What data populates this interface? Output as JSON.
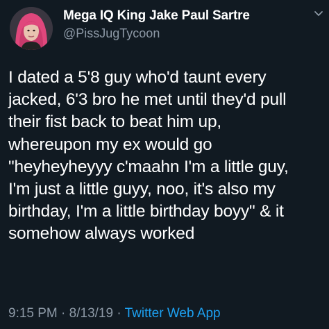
{
  "tweet": {
    "author": {
      "display_name": "Mega IQ King Jake Paul Sartre",
      "handle": "@PissJugTycoon",
      "avatar": "profile-photo"
    },
    "menu_icon": "chevron-down-icon",
    "body_lines": [
      "I dated a 5'8 guy who'd taunt every",
      "jacked, 6'3 bro he met until they'd pull",
      "their fist back to beat him up,",
      "whereupon my ex would go",
      "\"heyheyheyyy c'maahn I'm a little guy,",
      "I'm just a little guyy, noo, it's also my",
      "birthday, I'm a little birthday boyy\" & it",
      "somehow always worked"
    ],
    "time": "9:15 PM",
    "separator": "·",
    "date": "8/13/19",
    "source": "Twitter Web App"
  },
  "colors": {
    "background": "#111a22",
    "text": "#ffffff",
    "secondary_text": "#8d99a6",
    "link": "#1da1f2"
  }
}
